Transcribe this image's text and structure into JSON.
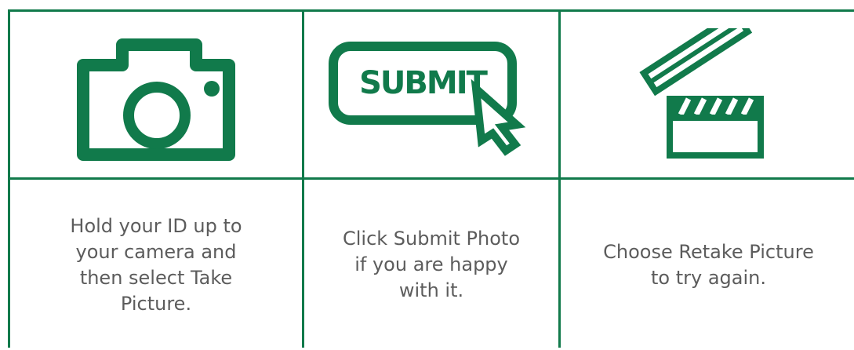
{
  "theme": {
    "accent": "#117a4b",
    "text": "#5c5c5c",
    "background": "#ffffff"
  },
  "steps": [
    {
      "icon": "camera-icon",
      "text": "Hold your ID up to your camera and then select Take Picture."
    },
    {
      "icon": "submit-button-icon",
      "icon_text": "SUBMIT",
      "text": "Click Submit Photo if you are happy with it."
    },
    {
      "icon": "clapperboard-icon",
      "text": "Choose Retake Picture to try again."
    }
  ]
}
